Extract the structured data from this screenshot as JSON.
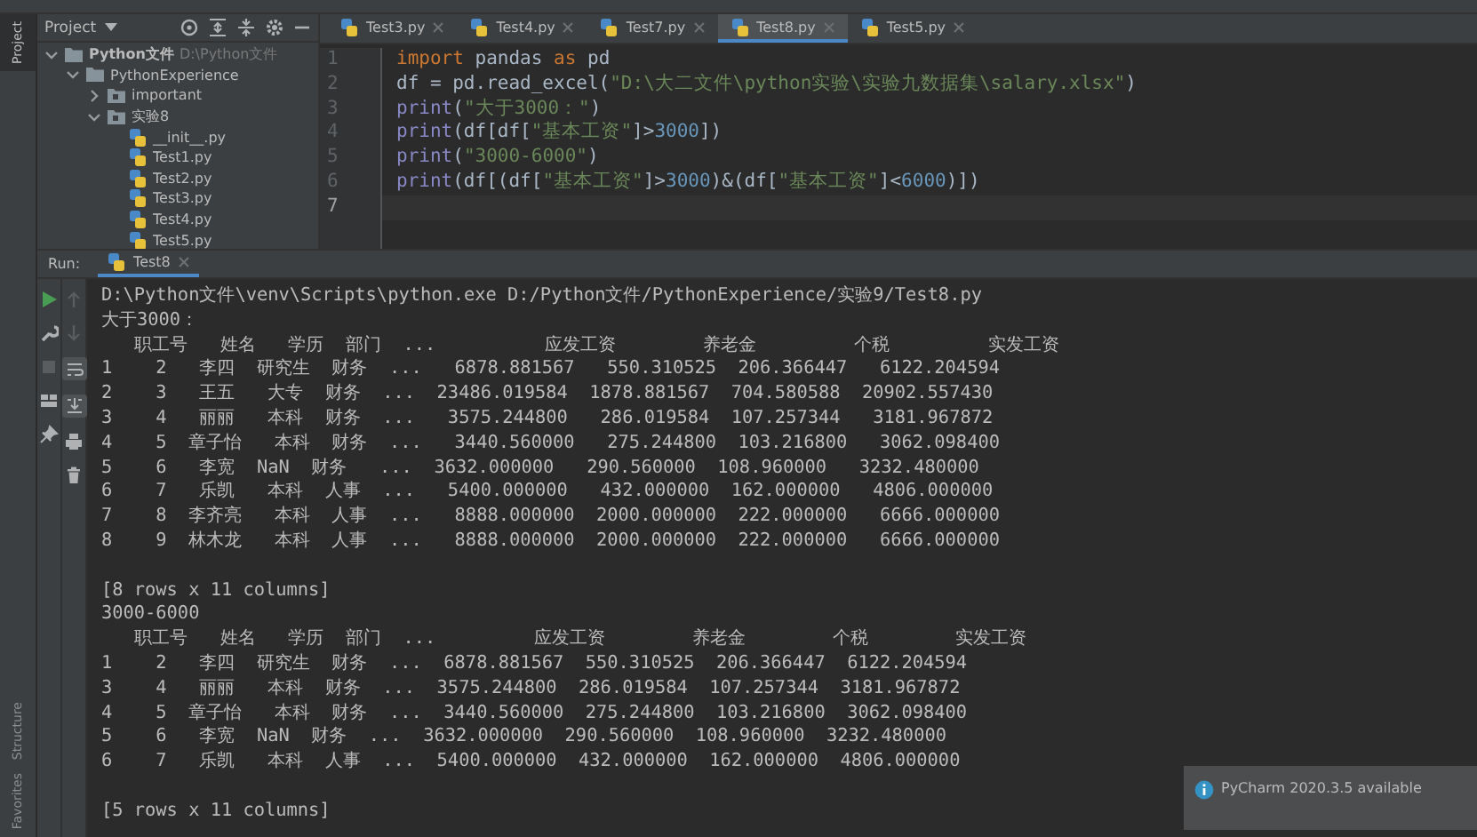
{
  "left_strip": {
    "top_label": "Project",
    "bottom_labels": [
      "Structure",
      "Favorites"
    ]
  },
  "project_panel": {
    "title": "Project",
    "tree": [
      {
        "name": "Python文件",
        "hint": "D:\\Python文件",
        "kind": "folder",
        "expanded": true,
        "children": [
          {
            "name": "PythonExperience",
            "kind": "folder",
            "expanded": true,
            "children": [
              {
                "name": "important",
                "kind": "package",
                "expanded": false
              },
              {
                "name": "实验8",
                "kind": "package",
                "expanded": true,
                "children": [
                  {
                    "name": "__init__.py",
                    "kind": "python"
                  },
                  {
                    "name": "Test1.py",
                    "kind": "python"
                  },
                  {
                    "name": "Test2.py",
                    "kind": "python"
                  },
                  {
                    "name": "Test3.py",
                    "kind": "python"
                  },
                  {
                    "name": "Test4.py",
                    "kind": "python"
                  },
                  {
                    "name": "Test5.py",
                    "kind": "python"
                  }
                ]
              }
            ]
          }
        ]
      }
    ]
  },
  "editor": {
    "tabs": [
      {
        "label": "Test3.py",
        "selected": false
      },
      {
        "label": "Test4.py",
        "selected": false
      },
      {
        "label": "Test7.py",
        "selected": false
      },
      {
        "label": "Test8.py",
        "selected": true
      },
      {
        "label": "Test5.py",
        "selected": false
      }
    ],
    "line_numbers": [
      {
        "text": "1",
        "current": false
      },
      {
        "text": "2",
        "current": false
      },
      {
        "text": "3",
        "current": false
      },
      {
        "text": "4",
        "current": false
      },
      {
        "text": "5",
        "current": false
      },
      {
        "text": "6",
        "current": false
      },
      {
        "text": "7",
        "current": true
      }
    ],
    "code": [
      {
        "tokens": [
          {
            "kind": "keyword",
            "text": "import"
          },
          {
            "kind": "plain",
            "text": " pandas "
          },
          {
            "kind": "keyword",
            "text": "as"
          },
          {
            "kind": "plain",
            "text": " pd"
          }
        ]
      },
      {
        "tokens": [
          {
            "kind": "plain",
            "text": "df = pd.read_excel("
          },
          {
            "kind": "string",
            "text": "\"D:\\大二文件\\python实验\\实验九数据集\\salary.xlsx\""
          },
          {
            "kind": "plain",
            "text": ")"
          }
        ]
      },
      {
        "tokens": [
          {
            "kind": "builtin",
            "text": "print"
          },
          {
            "kind": "plain",
            "text": "("
          },
          {
            "kind": "string",
            "text": "\"大于3000：\""
          },
          {
            "kind": "plain",
            "text": ")"
          }
        ]
      },
      {
        "tokens": [
          {
            "kind": "builtin",
            "text": "print"
          },
          {
            "kind": "plain",
            "text": "(df[df["
          },
          {
            "kind": "string",
            "text": "\"基本工资\""
          },
          {
            "kind": "plain",
            "text": "]>"
          },
          {
            "kind": "number",
            "text": "3000"
          },
          {
            "kind": "plain",
            "text": "])"
          }
        ]
      },
      {
        "tokens": [
          {
            "kind": "builtin",
            "text": "print"
          },
          {
            "kind": "plain",
            "text": "("
          },
          {
            "kind": "string",
            "text": "\"3000-6000\""
          },
          {
            "kind": "plain",
            "text": ")"
          }
        ]
      },
      {
        "tokens": [
          {
            "kind": "builtin",
            "text": "print"
          },
          {
            "kind": "plain",
            "text": "(df[(df["
          },
          {
            "kind": "string",
            "text": "\"基本工资\""
          },
          {
            "kind": "plain",
            "text": "]>"
          },
          {
            "kind": "number",
            "text": "3000"
          },
          {
            "kind": "plain",
            "text": ")&(df["
          },
          {
            "kind": "string",
            "text": "\"基本工资\""
          },
          {
            "kind": "plain",
            "text": "]<"
          },
          {
            "kind": "number",
            "text": "6000"
          },
          {
            "kind": "plain",
            "text": ")])"
          }
        ]
      }
    ]
  },
  "run": {
    "label": "Run:",
    "tab": "Test8",
    "output": [
      {
        "lines": [
          "D:\\Python文件\\venv\\Scripts\\python.exe D:/Python文件/PythonExperience/实验9/Test8.py",
          "大于3000：",
          "   职工号   姓名   学历  部门  ...          应发工资        养老金         个税         实发工资",
          "1    2   李四  研究生  财务  ...   6878.881567   550.310525  206.366447   6122.204594",
          "2    3   王五   大专  财务  ...  23486.019584  1878.881567  704.580588  20902.557430",
          "3    4   丽丽   本科  财务  ...   3575.244800   286.019584  107.257344   3181.967872",
          "4    5  章子怡   本科  财务  ...   3440.560000   275.244800  103.216800   3062.098400",
          "5    6   李宽  NaN  财务   ...  3632.000000   290.560000  108.960000   3232.480000",
          "6    7   乐凯   本科  人事  ...   5400.000000   432.000000  162.000000   4806.000000",
          "7    8  李齐亮   本科  人事  ...   8888.000000  2000.000000  222.000000   6666.000000",
          "8    9  林木龙   本科  人事  ...   8888.000000  2000.000000  222.000000   6666.000000"
        ]
      },
      {
        "lines": [
          "[8 rows x 11 columns]",
          "3000-6000",
          "   职工号   姓名   学历  部门  ...         应发工资        养老金        个税        实发工资",
          "1    2   李四  研究生  财务  ...  6878.881567  550.310525  206.366447  6122.204594",
          "3    4   丽丽   本科  财务  ...  3575.244800  286.019584  107.257344  3181.967872",
          "4    5  章子怡   本科  财务  ...  3440.560000  275.244800  103.216800  3062.098400",
          "5    6   李宽  NaN  财务  ...  3632.000000  290.560000  108.960000  3232.480000",
          "6    7   乐凯   本科  人事  ...  5400.000000  432.000000  162.000000  4806.000000"
        ]
      },
      {
        "lines": [
          "[5 rows x 11 columns]"
        ]
      }
    ]
  },
  "notification": {
    "title": "PyCharm 2020.3.5 available"
  }
}
